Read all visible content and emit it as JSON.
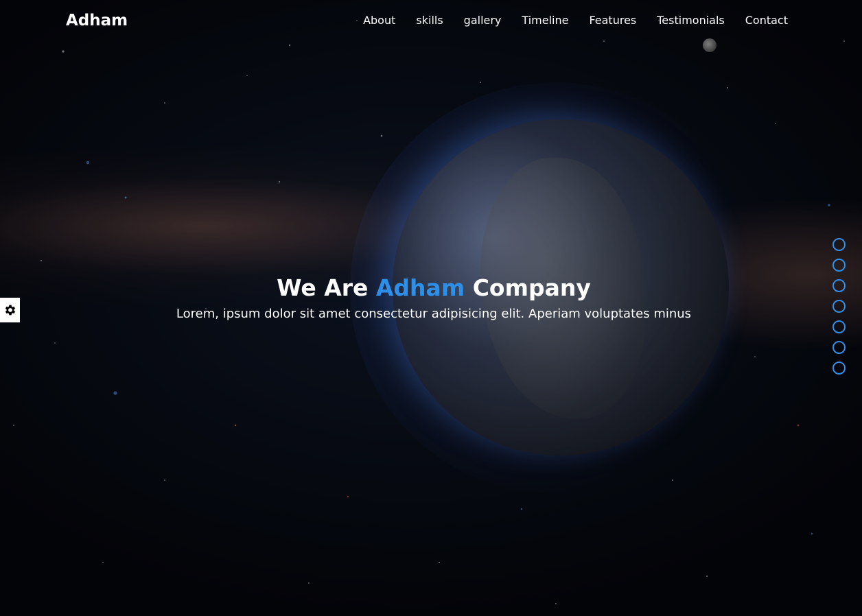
{
  "nav": {
    "logo": "Adham",
    "links": [
      "About",
      "skills",
      "gallery",
      "Timeline",
      "Features",
      "Testimonials",
      "Contact"
    ]
  },
  "hero": {
    "title_prefix": "We Are ",
    "title_accent": "Adham",
    "title_suffix": " Company",
    "subtitle": "Lorem, ipsum dolor sit amet consectetur adipisicing elit. Aperiam voluptates minus"
  },
  "settings": {
    "icon": "gear-icon"
  },
  "bullets": {
    "count": 7
  },
  "colors": {
    "accent": "#2e8fe8",
    "text": "#ffffff",
    "background": "#05070c"
  }
}
